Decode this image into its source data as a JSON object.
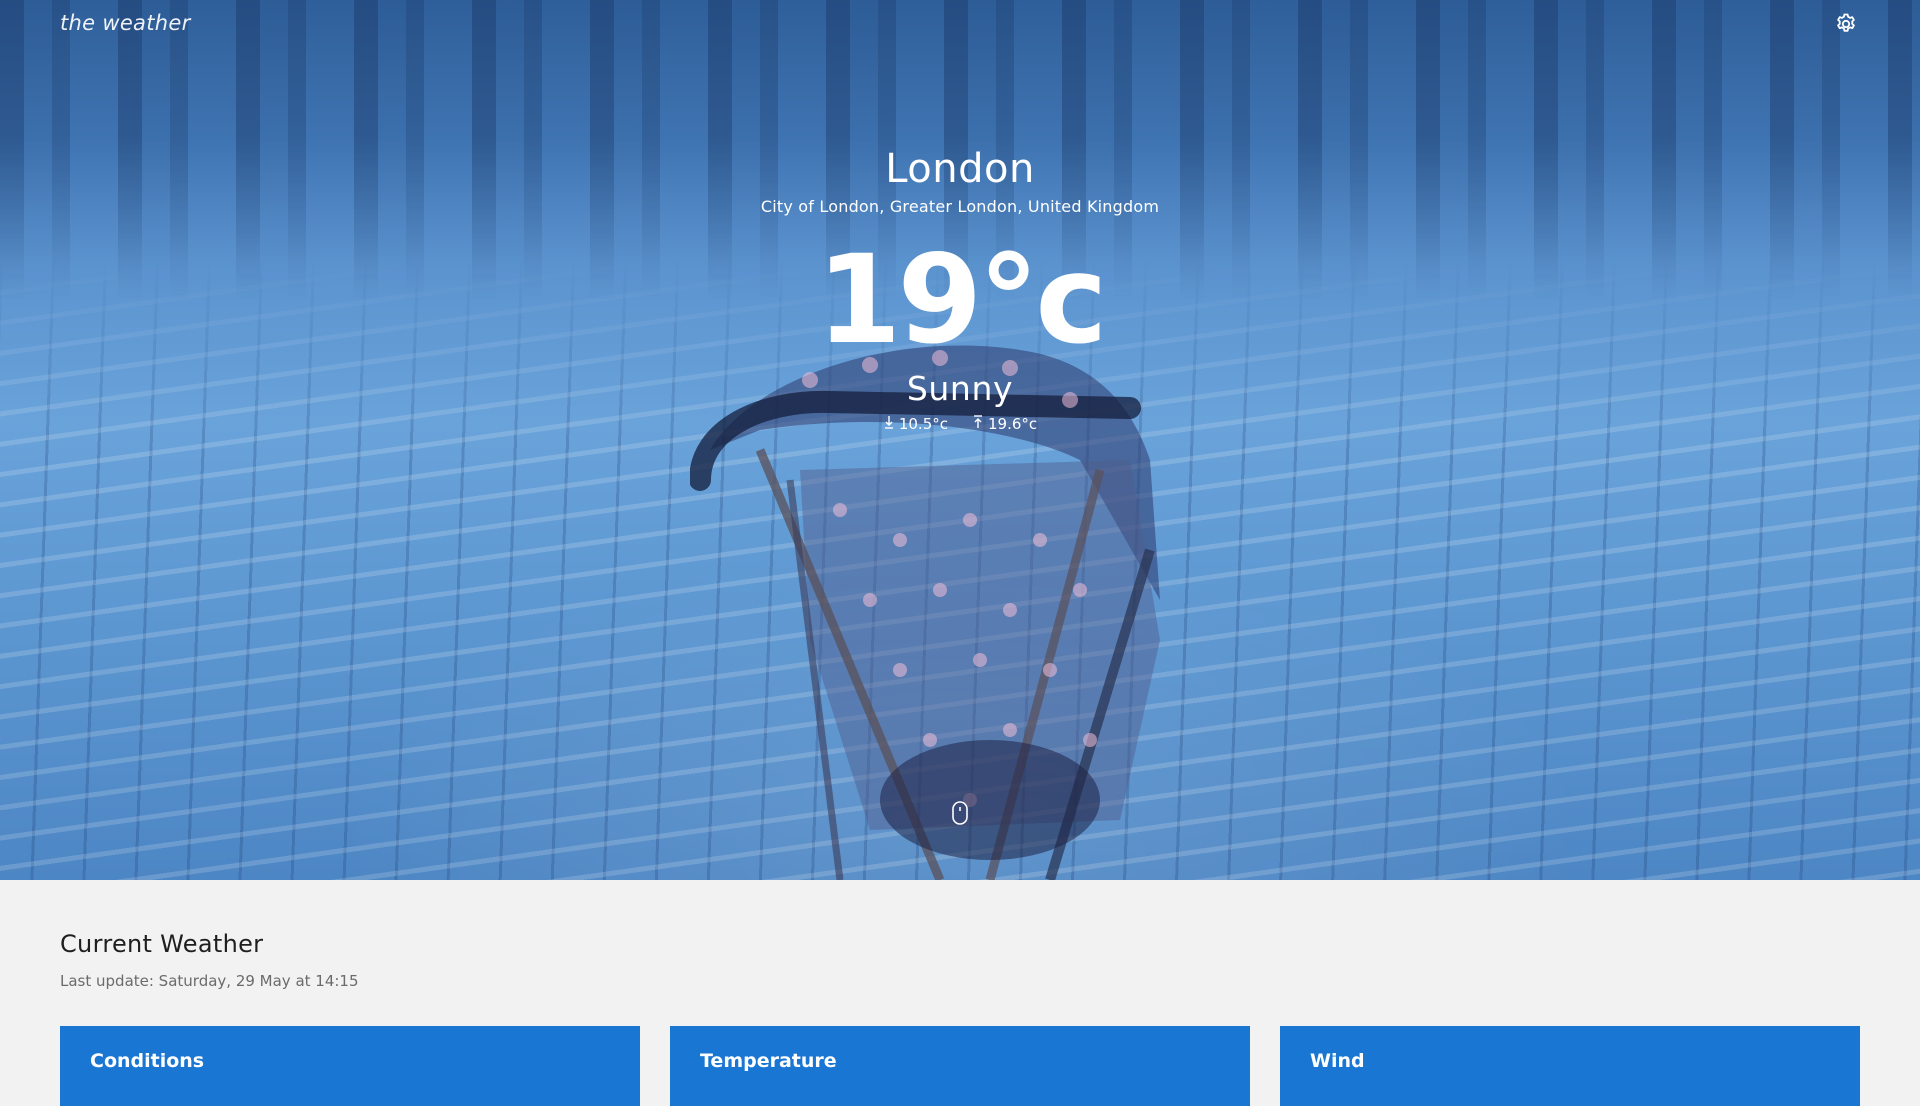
{
  "app": {
    "brand": "the weather"
  },
  "location": {
    "city": "London",
    "region": "City of London, Greater London, United Kingdom"
  },
  "weather": {
    "temperature": "19°c",
    "condition": "Sunny",
    "min_temp": "10.5°c",
    "max_temp": "19.6°c"
  },
  "current_section": {
    "title": "Current Weather",
    "last_update": "Last update: Saturday, 29 May at 14:15",
    "cards": [
      {
        "title": "Conditions"
      },
      {
        "title": "Temperature"
      },
      {
        "title": "Wind"
      }
    ]
  },
  "icons": {
    "settings": "gear-icon",
    "min": "arrow-down-to-line-icon",
    "max": "arrow-up-from-line-icon",
    "scroll": "mouse-icon"
  },
  "colors": {
    "overlay_blue": "#4d86c4",
    "card_blue": "#1976d2",
    "section_bg": "#f2f2f2"
  }
}
